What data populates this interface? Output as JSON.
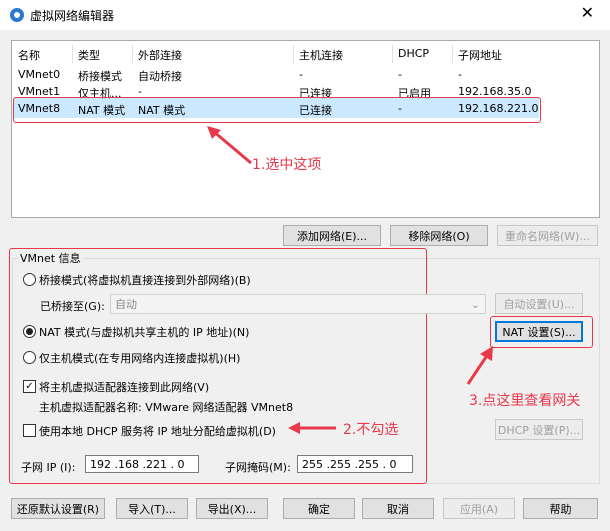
{
  "window": {
    "title": "虚拟网络编辑器",
    "close_glyph": "✕"
  },
  "table": {
    "headers": [
      "名称",
      "类型",
      "外部连接",
      "主机连接",
      "DHCP",
      "子网地址"
    ],
    "rows": [
      [
        "VMnet0",
        "桥接模式",
        "自动桥接",
        "-",
        "-",
        "-"
      ],
      [
        "VMnet1",
        "仅主机...",
        "-",
        "已连接",
        "已启用",
        "192.168.35.0"
      ],
      [
        "VMnet8",
        "NAT 模式",
        "NAT 模式",
        "已连接",
        "-",
        "192.168.221.0"
      ]
    ],
    "selected_row": 2
  },
  "buttons": {
    "add": "添加网络(E)...",
    "remove": "移除网络(O)",
    "rename": "重命名网络(W)..."
  },
  "vmnet_info": {
    "title": "VMnet 信息",
    "bridged": "桥接模式(将虚拟机直接连接到外部网络)(B)",
    "bridged_to_label": "已桥接至(G):",
    "bridged_to_value": "自动",
    "auto_settings": "自动设置(U)...",
    "nat": "NAT 模式(与虚拟机共享主机的 IP 地址)(N)",
    "nat_settings": "NAT 设置(S)...",
    "host_only": "仅主机模式(在专用网络内连接虚拟机)(H)",
    "connect_adapter": "将主机虚拟适配器连接到此网络(V)",
    "adapter_name": "主机虚拟适配器名称: VMware 网络适配器 VMnet8",
    "use_dhcp": "使用本地 DHCP 服务将 IP 地址分配给虚拟机(D)",
    "dhcp_settings": "DHCP 设置(P)...",
    "subnet_ip_label": "子网 IP (I):",
    "subnet_ip": "192 .168 .221 .  0",
    "subnet_mask_label": "子网掩码(M):",
    "subnet_mask": "255 .255 .255 .  0"
  },
  "footer": {
    "restore": "还原默认设置(R)",
    "import": "导入(T)...",
    "export": "导出(X)...",
    "ok": "确定",
    "cancel": "取消",
    "apply": "应用(A)",
    "help": "帮助"
  },
  "annotations": {
    "a1": "1.选中这项",
    "a2": "2.不勾选",
    "a3": "3.点这里查看网关"
  },
  "colors": {
    "annotation": "#e8394a",
    "selection": "#cce8ff"
  }
}
